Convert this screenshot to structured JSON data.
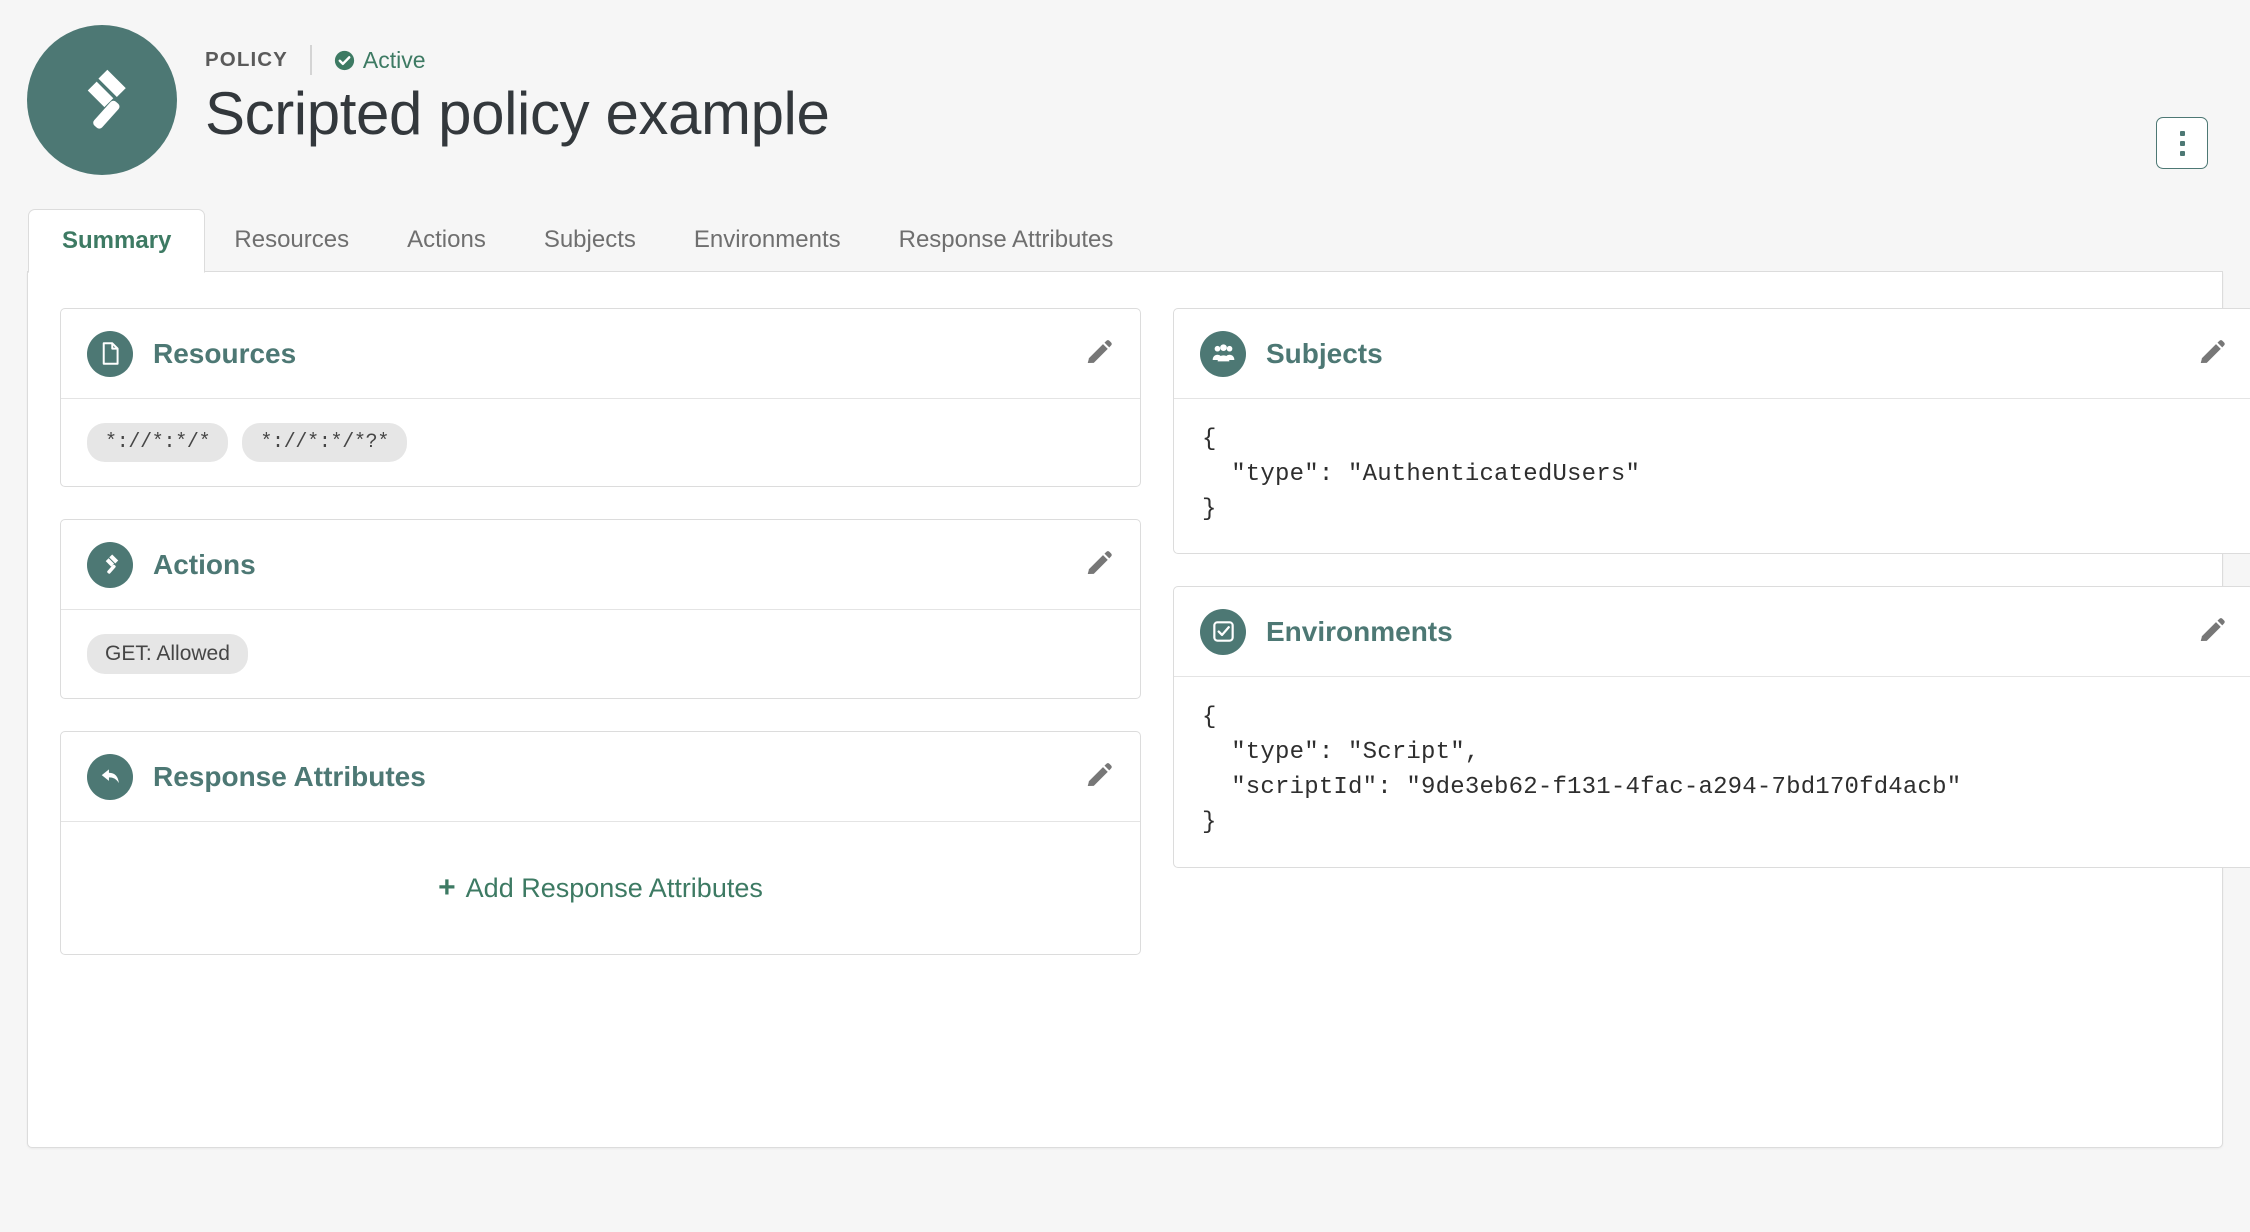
{
  "header": {
    "eyebrow": "POLICY",
    "status": "Active",
    "status_icon": "check-circle-icon",
    "title": "Scripted policy example",
    "avatar_icon": "gavel-icon",
    "menu_icon": "kebab-menu-icon"
  },
  "tabs": [
    {
      "label": "Summary",
      "active": true
    },
    {
      "label": "Resources",
      "active": false
    },
    {
      "label": "Actions",
      "active": false
    },
    {
      "label": "Subjects",
      "active": false
    },
    {
      "label": "Environments",
      "active": false
    },
    {
      "label": "Response Attributes",
      "active": false
    }
  ],
  "cards": {
    "resources": {
      "title": "Resources",
      "icon": "document-icon",
      "edit_icon": "pencil-icon",
      "chips": [
        "*://*:*/*",
        "*://*:*/*?*"
      ]
    },
    "actions": {
      "title": "Actions",
      "icon": "gavel-icon",
      "edit_icon": "pencil-icon",
      "chips": [
        "GET: Allowed"
      ]
    },
    "response_attributes": {
      "title": "Response Attributes",
      "icon": "reply-arrow-icon",
      "edit_icon": "pencil-icon",
      "add_label": "Add Response Attributes",
      "add_icon": "plus-icon"
    },
    "subjects": {
      "title": "Subjects",
      "icon": "users-group-icon",
      "edit_icon": "pencil-icon",
      "code": "{\n  \"type\": \"AuthenticatedUsers\"\n}"
    },
    "environments": {
      "title": "Environments",
      "icon": "checkbox-checked-icon",
      "edit_icon": "pencil-icon",
      "code": "{\n  \"type\": \"Script\",\n  \"scriptId\": \"9de3eb62-f131-4fac-a294-7bd170fd4acb\"\n}"
    }
  },
  "colors": {
    "brand": "#4d7874",
    "accent_green": "#3d7a63",
    "page_background": "#f6f6f6",
    "card_border": "#dcdcdc",
    "chip_background": "#e6e6e6",
    "title_text": "#33383c"
  }
}
